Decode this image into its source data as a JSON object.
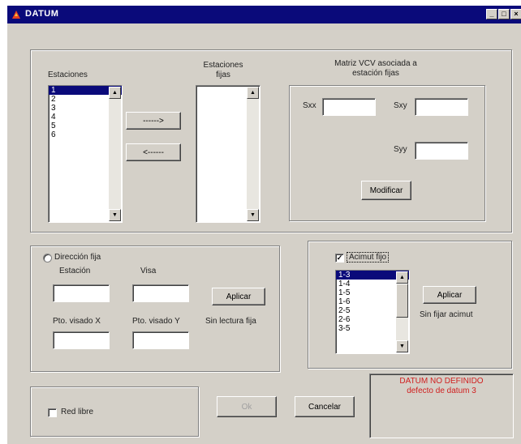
{
  "window": {
    "title": "DATUM",
    "min_glyph": "_",
    "max_glyph": "□",
    "close_glyph": "×"
  },
  "stations": {
    "label": "Estaciones",
    "items": [
      "1",
      "2",
      "3",
      "4",
      "5",
      "6"
    ],
    "selected": "1"
  },
  "fixed_stations": {
    "label_line1": "Estaciones",
    "label_line2": "fijas",
    "items": []
  },
  "transfer": {
    "add_label": "------>",
    "remove_label": "<------"
  },
  "vcv": {
    "title_line1": "Matriz VCV asociada a",
    "title_line2": "estación fijas",
    "sxx_label": "Sxx",
    "sxx_value": "",
    "sxy_label": "Sxy",
    "sxy_value": "",
    "syy_label": "Syy",
    "syy_value": "",
    "modify_label": "Modificar"
  },
  "direction": {
    "radio_label": "Dirección fija",
    "checked": false,
    "station_label": "Estación",
    "sight_label": "Visa",
    "station_value": "",
    "sight_value": "",
    "ptx_label": "Pto. visado X",
    "pty_label": "Pto. visado Y",
    "ptx_value": "",
    "pty_value": "",
    "apply_label": "Aplicar",
    "status": "Sin lectura fija"
  },
  "azimuth": {
    "check_label": "Acimut fijo",
    "checked": true,
    "check_glyph": "✓",
    "items": [
      "1-3",
      "1-4",
      "1-5",
      "1-6",
      "2-5",
      "2-6",
      "3-5"
    ],
    "selected": "1-3",
    "apply_label": "Aplicar",
    "status": "Sin fijar acimut"
  },
  "footer": {
    "free_network_label": "Red libre",
    "free_network_checked": false,
    "ok_label": "Ok",
    "cancel_label": "Cancelar",
    "datum_status_line1": "DATUM NO DEFINIDO",
    "datum_status_line2": "defecto de datum 3"
  },
  "colors": {
    "face": "#d4d0c8",
    "titlebar": "#0a0a7a",
    "selection": "#0a0a7a",
    "error_text": "#d02020"
  },
  "icons": {
    "app": "app-icon",
    "scroll_up": "▲",
    "scroll_down": "▼"
  }
}
